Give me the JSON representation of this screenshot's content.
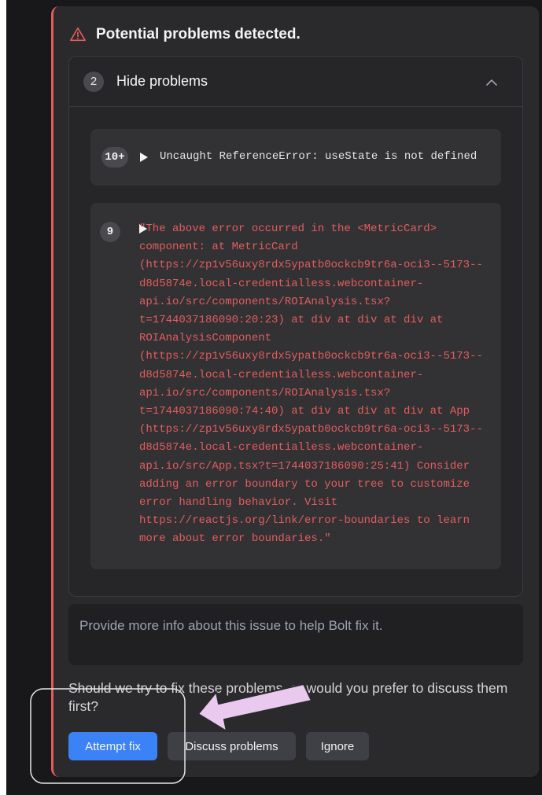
{
  "panel": {
    "title": "Potential problems detected.",
    "warning_icon": "warning-triangle-icon",
    "accent_color": "#e35c5c"
  },
  "problems": {
    "count": "2",
    "toggle_label": "Hide problems",
    "toggle_icon": "chevron-up-icon",
    "errors": [
      {
        "badge": "10+",
        "text": "Uncaught ReferenceError: useState is not defined"
      },
      {
        "badge": "9",
        "text": "\"The above error occurred in the <MetricCard>\ncomponent: at MetricCard\n(https://zp1v56uxy8rdx5ypatb0ockcb9tr6a-oci3--5173--\nd8d5874e.local-credentialless.webcontainer-\napi.io/src/components/ROIAnalysis.tsx?\nt=1744037186090:20:23) at div at div at div at\nROIAnalysisComponent\n(https://zp1v56uxy8rdx5ypatb0ockcb9tr6a-oci3--5173--\nd8d5874e.local-credentialless.webcontainer-\napi.io/src/components/ROIAnalysis.tsx?\nt=1744037186090:74:40) at div at div at div at App\n(https://zp1v56uxy8rdx5ypatb0ockcb9tr6a-oci3--5173--\nd8d5874e.local-credentialless.webcontainer-\napi.io/src/App.tsx?t=1744037186090:25:41) Consider\nadding an error boundary to your tree to customize\nerror handling behavior. Visit\nhttps://reactjs.org/link/error-boundaries to learn\nmore about error boundaries.\""
      }
    ]
  },
  "info_input": {
    "placeholder": "Provide more info about this issue to help Bolt fix it."
  },
  "question": "Should we try to fix these problems, or would you prefer to discuss them first?",
  "buttons": {
    "attempt_fix": "Attempt fix",
    "discuss": "Discuss problems",
    "ignore": "Ignore"
  },
  "colors": {
    "primary_button": "#3b82f6",
    "annotation_arrow": "#e9c9ee"
  }
}
